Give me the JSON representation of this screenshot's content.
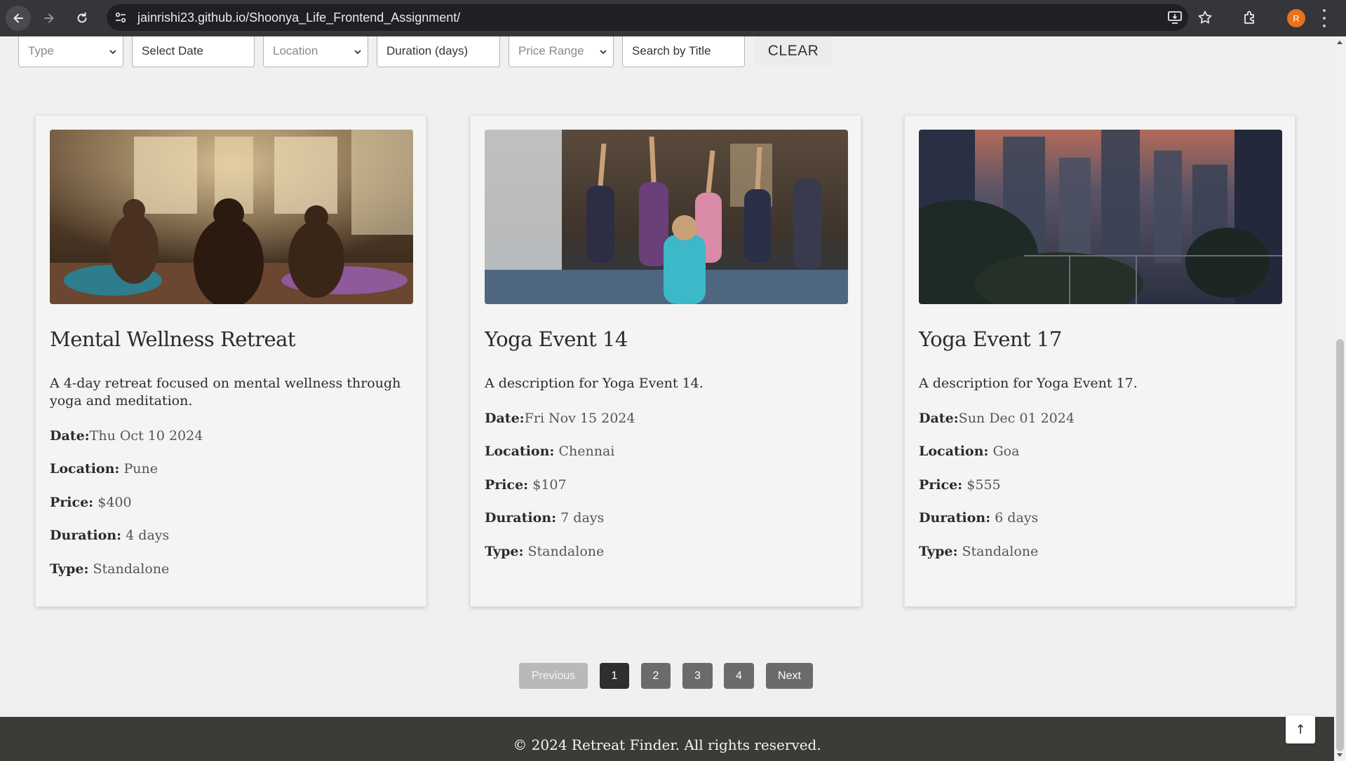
{
  "browser": {
    "url": "jainrishi23.github.io/Shoonya_Life_Frontend_Assignment/",
    "profile_initial": "R",
    "accent_color": "#e8711a"
  },
  "filters": {
    "type": "Type",
    "date": "Select Date",
    "location": "Location",
    "duration": "Duration (days)",
    "price_range": "Price Range",
    "search": "Search by Title",
    "clear": "CLEAR"
  },
  "labels": {
    "date": "Date:",
    "location": "Location:",
    "price": "Price:",
    "duration": "Duration:",
    "type": "Type:"
  },
  "cards": [
    {
      "image_icon": "yoga-studio-meditation-photo",
      "title": "Mental Wellness Retreat",
      "description": "A 4-day retreat focused on mental wellness through yoga and meditation.",
      "date": "Thu Oct 10 2024",
      "location": "Pune",
      "price": "$400",
      "duration": "4 days",
      "type": "Standalone"
    },
    {
      "image_icon": "yoga-class-photo",
      "title": "Yoga Event 14",
      "description": "A description for Yoga Event 14.",
      "date": "Fri Nov 15 2024",
      "location": "Chennai",
      "price": "$107",
      "duration": "7 days",
      "type": "Standalone"
    },
    {
      "image_icon": "city-skyline-dusk-photo",
      "title": "Yoga Event 17",
      "description": "A description for Yoga Event 17.",
      "date": "Sun Dec 01 2024",
      "location": "Goa",
      "price": "$555",
      "duration": "6 days",
      "type": "Standalone"
    }
  ],
  "pagination": {
    "previous": "Previous",
    "pages": [
      "1",
      "2",
      "3",
      "4"
    ],
    "current": "1",
    "next": "Next"
  },
  "footer": {
    "text": "© 2024 Retreat Finder. All rights reserved."
  },
  "scroll_top": {
    "icon": "up-arrow-icon",
    "label": "↑"
  }
}
